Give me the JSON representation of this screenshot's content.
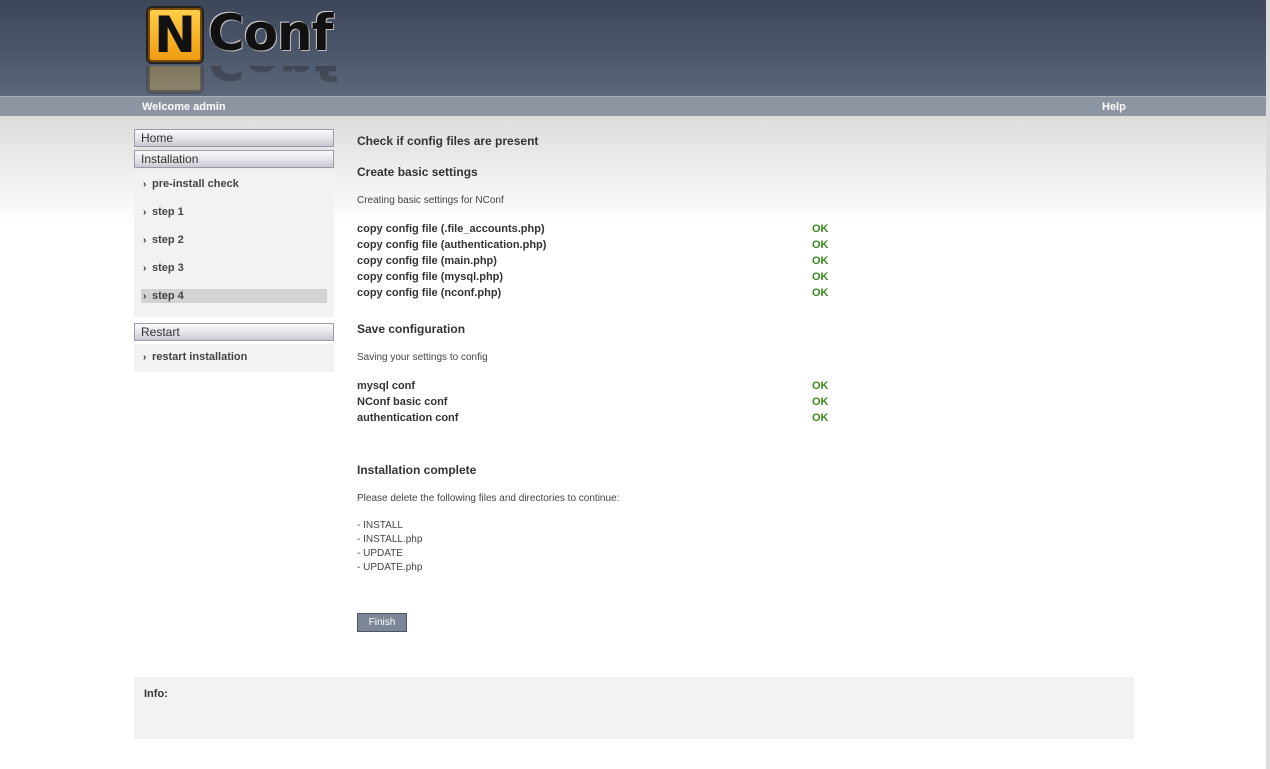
{
  "header": {
    "logo_letter": "N",
    "logo_word": "Conf",
    "welcome": "Welcome admin",
    "help": "Help"
  },
  "sidebar": {
    "home": "Home",
    "installation": "Installation",
    "items": [
      "pre-install check",
      "step 1",
      "step 2",
      "step 3",
      "step 4"
    ],
    "active_item": "step 4",
    "restart": "Restart",
    "restart_item": "restart installation"
  },
  "main": {
    "check_title": "Check if config files are present",
    "basic_title": "Create basic settings",
    "basic_desc": "Creating basic settings for NConf",
    "copy_rows": [
      {
        "label": "copy config file (.file_accounts.php)",
        "status": "OK"
      },
      {
        "label": "copy config file (authentication.php)",
        "status": "OK"
      },
      {
        "label": "copy config file (main.php)",
        "status": "OK"
      },
      {
        "label": "copy config file (mysql.php)",
        "status": "OK"
      },
      {
        "label": "copy config file (nconf.php)",
        "status": "OK"
      }
    ],
    "save_title": "Save configuration",
    "save_desc": "Saving your settings to config",
    "save_rows": [
      {
        "label": "mysql conf",
        "status": "OK"
      },
      {
        "label": "NConf basic conf",
        "status": "OK"
      },
      {
        "label": "authentication conf",
        "status": "OK"
      }
    ],
    "complete_title": "Installation complete",
    "complete_desc": "Please delete the following files and directories to continue:",
    "files": [
      "- INSTALL",
      "- INSTALL.php",
      "- UPDATE",
      "- UPDATE.php"
    ],
    "finish_label": "Finish"
  },
  "info": {
    "label": "Info:"
  },
  "colors": {
    "header": "#4b5569",
    "topbar": "#8d95a3",
    "ok": "#3a8a1a",
    "button": "#7c8697"
  }
}
